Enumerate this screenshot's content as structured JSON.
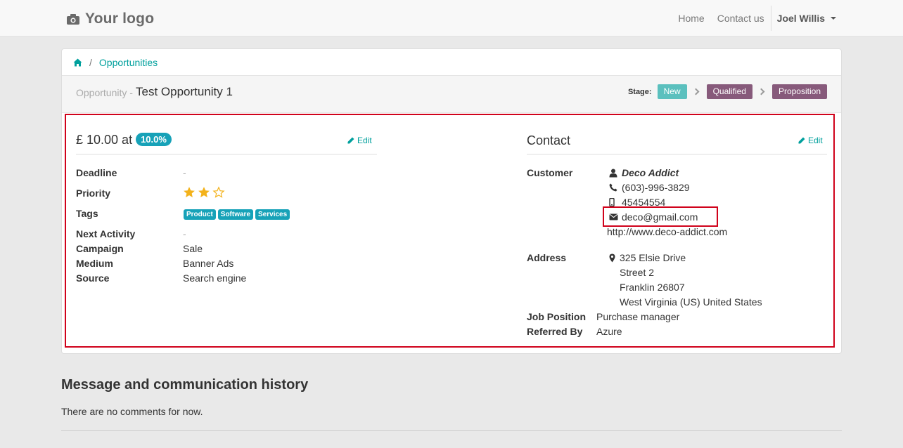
{
  "nav": {
    "logo_text": "Your logo",
    "links": [
      "Home",
      "Contact us"
    ],
    "user": "Joel Willis"
  },
  "breadcrumb": {
    "items": [
      "Opportunities"
    ]
  },
  "header": {
    "prefix": "Opportunity -",
    "title": "Test Opportunity 1",
    "stage_label": "Stage:",
    "stages": [
      {
        "label": "New",
        "color": "#5bc0be"
      },
      {
        "label": "Qualified",
        "color": "#875a7b"
      },
      {
        "label": "Proposition",
        "color": "#875a7b"
      }
    ]
  },
  "opportunity": {
    "amount": "£ 10.00 at",
    "probability": "10.0%",
    "edit_label": "Edit",
    "fields": {
      "deadline_label": "Deadline",
      "deadline_value": "-",
      "priority_label": "Priority",
      "priority_stars": 2,
      "priority_max": 3,
      "tags_label": "Tags",
      "tags": [
        "Product",
        "Software",
        "Services"
      ],
      "next_activity_label": "Next Activity",
      "next_activity_value": "-",
      "campaign_label": "Campaign",
      "campaign_value": "Sale",
      "medium_label": "Medium",
      "medium_value": "Banner Ads",
      "source_label": "Source",
      "source_value": "Search engine"
    }
  },
  "contact": {
    "title": "Contact",
    "edit_label": "Edit",
    "customer_label": "Customer",
    "customer_name": "Deco Addict",
    "phone": "(603)-996-3829",
    "mobile": "45454554",
    "email": "deco@gmail.com",
    "website": "http://www.deco-addict.com",
    "address_label": "Address",
    "address_lines": [
      "325 Elsie Drive",
      "Street 2",
      "Franklin 26807",
      "West Virginia (US) United States"
    ],
    "job_position_label": "Job Position",
    "job_position_value": "Purchase manager",
    "referred_by_label": "Referred By",
    "referred_by_value": "Azure"
  },
  "history": {
    "title": "Message and communication history",
    "empty_text": "There are no comments for now."
  },
  "colors": {
    "accent": "#00a09d",
    "badge": "#17a2b8",
    "star": "#f3b21b",
    "highlight": "#d0021b"
  }
}
